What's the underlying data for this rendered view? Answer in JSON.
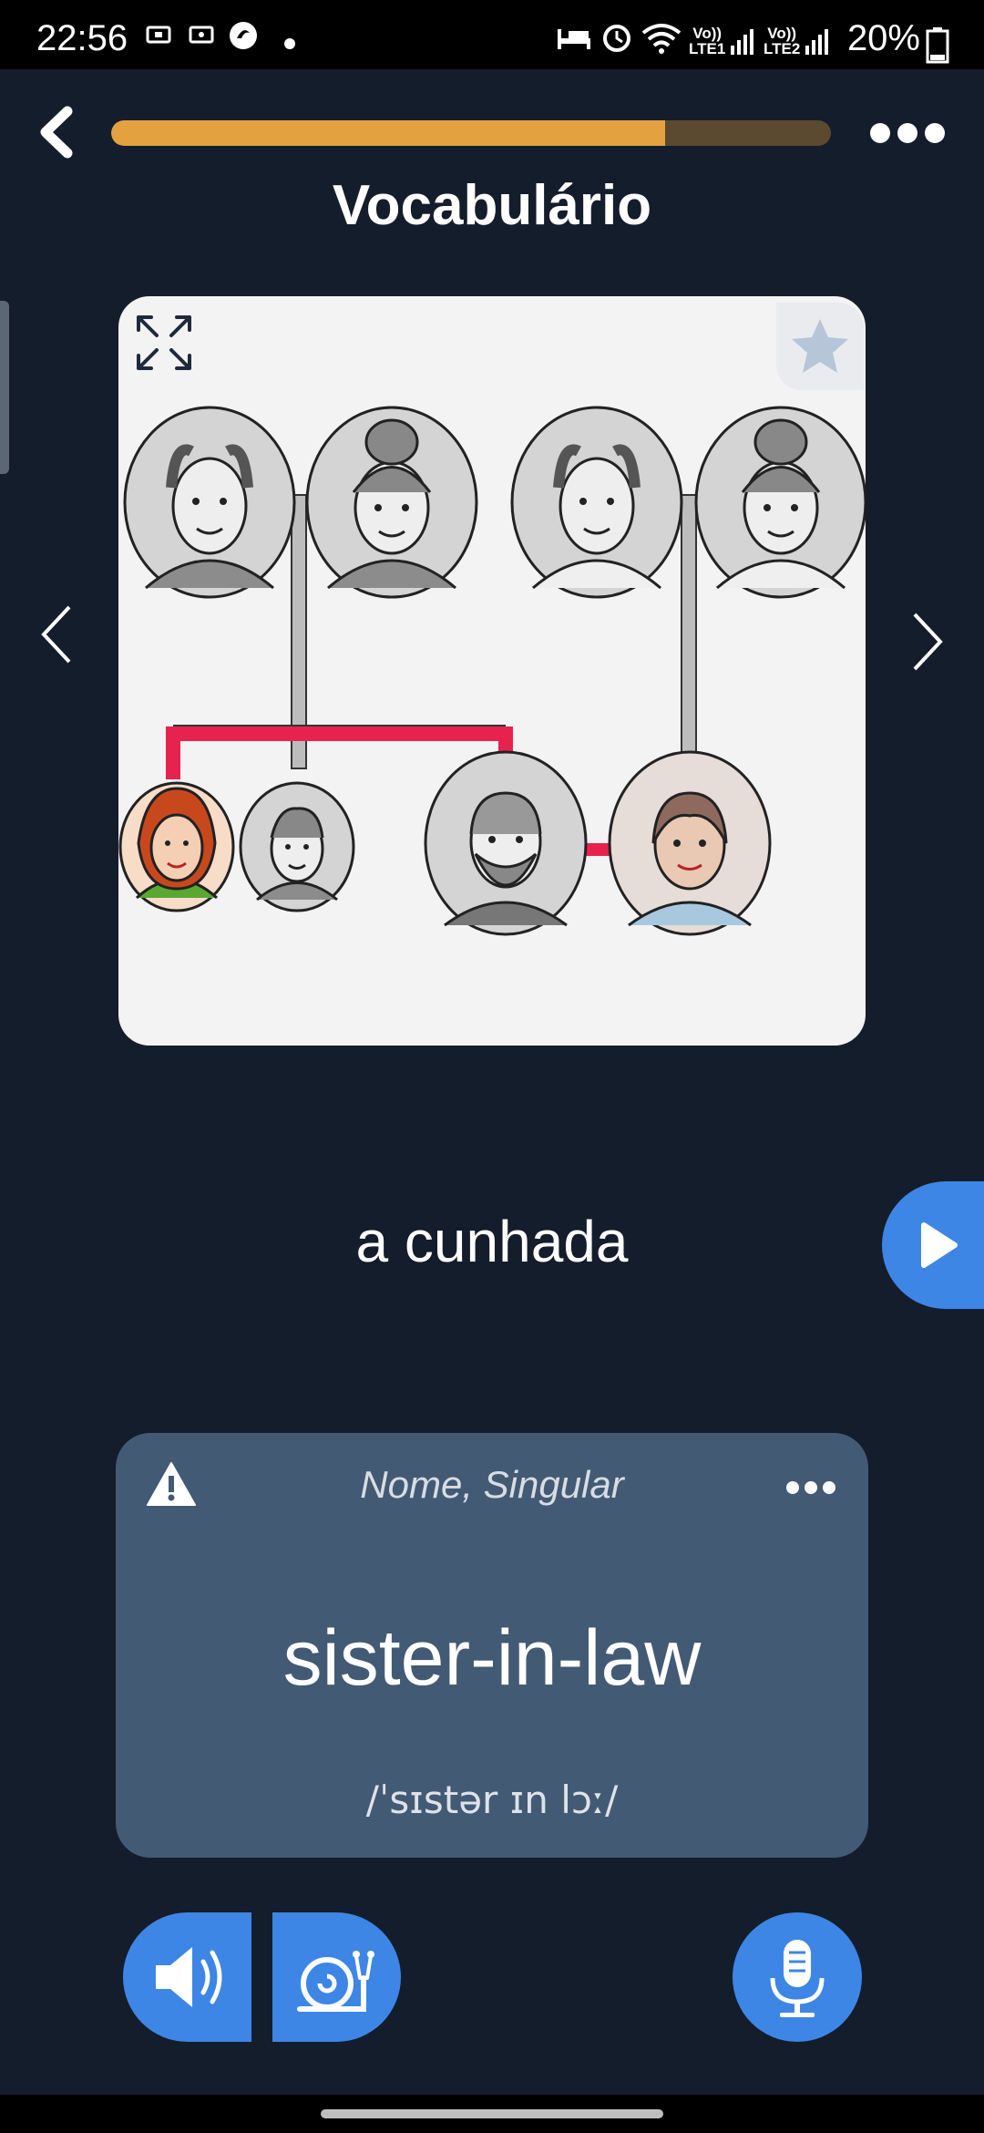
{
  "status_bar": {
    "time": "22:56",
    "network1": "LTE1",
    "network2": "LTE2",
    "volte1": "Vo))",
    "volte2": "Vo))",
    "battery": "20%"
  },
  "lesson": {
    "title": "Vocabulário",
    "progress_fraction": 0.77
  },
  "word": {
    "text": "a cunhada",
    "type": "Nome, Singular",
    "translation": "sister-in-law",
    "phonetic": "/ˈsɪstər ɪn lɔː/"
  },
  "colors": {
    "background": "#141d2b",
    "accent_blue": "#3d86e6",
    "progress_fill": "#e3a13f",
    "progress_track": "#5b4a30",
    "card": "#435a74",
    "family_line": "#e8224f"
  }
}
